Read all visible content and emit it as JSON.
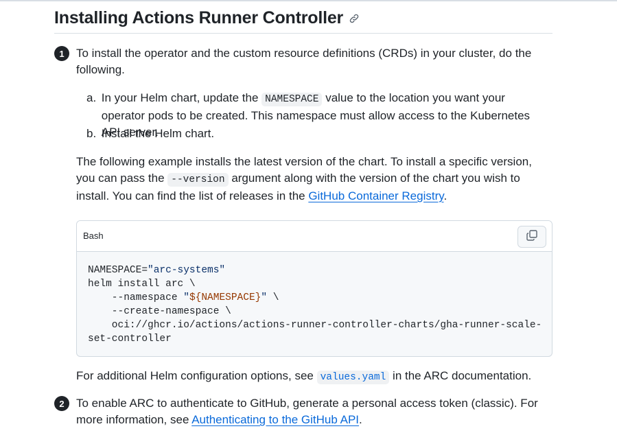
{
  "heading": "Installing Actions Runner Controller",
  "steps": [
    {
      "number": "1",
      "text": "To install the operator and the custom resource definitions (CRDs) in your cluster, do the following.",
      "substeps": [
        {
          "label": "a.",
          "before": "In your Helm chart, update the ",
          "code": "NAMESPACE",
          "after": " value to the location you want your operator pods to be created. This namespace must allow access to the Kubernetes API server."
        },
        {
          "label": "b.",
          "text": "Install the Helm chart."
        }
      ],
      "example": {
        "before": "The following example installs the latest version of the chart. To install a specific version, you can pass the ",
        "code": "--version",
        "middle": " argument along with the version of the chart you wish to install. You can find the list of releases in the ",
        "link": "GitHub Container Registry",
        "after": "."
      },
      "code_block": {
        "language": "Bash",
        "lines": {
          "l1_a": "NAMESPACE=",
          "l1_b": "\"arc-systems\"",
          "l2": "helm install arc \\",
          "l3_a": "    --namespace ",
          "l3_b": "\"",
          "l3_c": "${NAMESPACE}",
          "l3_d": "\"",
          "l3_e": " \\",
          "l4": "    --create-namespace \\",
          "l5": "    oci://ghcr.io/actions/actions-runner-controller-charts/gha-runner-scale-",
          "l6": "set-controller"
        }
      },
      "additional": {
        "before": "For additional Helm configuration options, see ",
        "code": "values.yaml",
        "after": " in the ARC documentation."
      }
    },
    {
      "number": "2",
      "before": "To enable ARC to authenticate to GitHub, generate a personal access token (classic). For more information, see ",
      "link": "Authenticating to the GitHub API",
      "after": "."
    }
  ],
  "icons": {
    "anchor": "link-icon",
    "copy": "copy-icon"
  }
}
